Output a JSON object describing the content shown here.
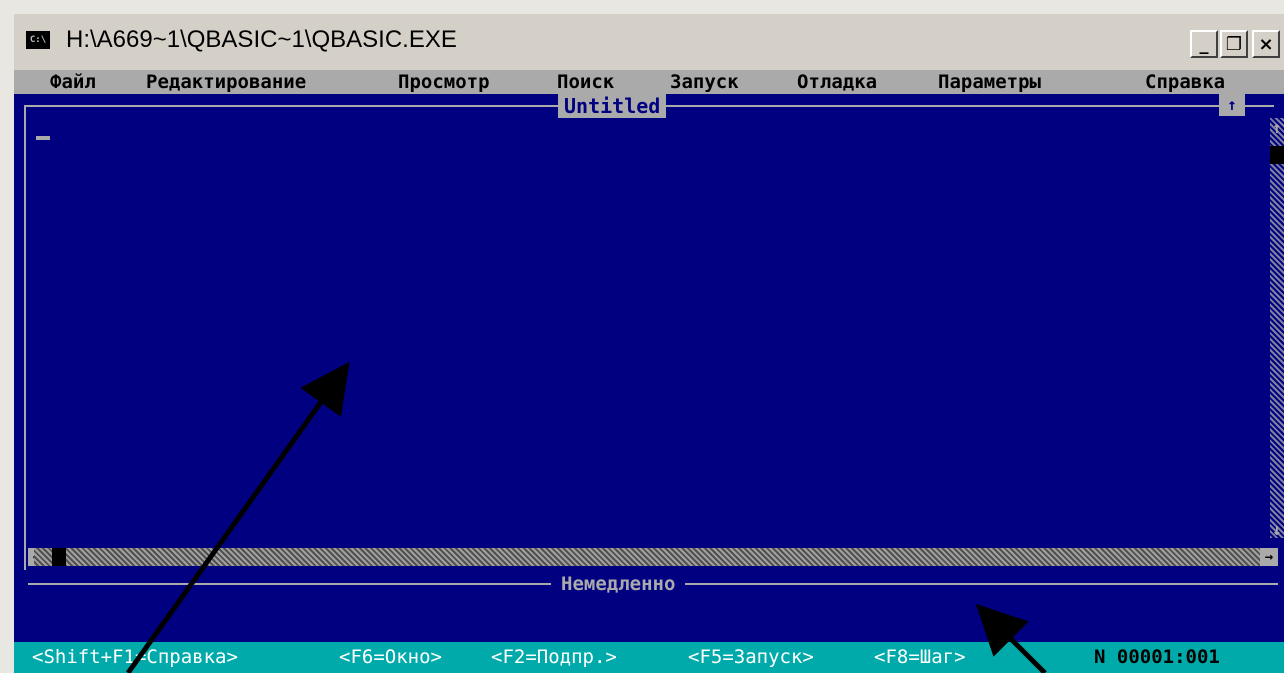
{
  "window": {
    "title": "H:\\A669~1\\QBASIC~1\\QBASIC.EXE",
    "icon_label": "C:\\",
    "minimize_glyph": "_",
    "restore_glyph": "❐",
    "close_glyph": "×"
  },
  "menu": {
    "items": [
      "Файл",
      "Редактирование",
      "Просмотр",
      "Поиск",
      "Запуск",
      "Отладка",
      "Параметры",
      "Справка"
    ]
  },
  "editor": {
    "title": "Untitled",
    "maximize_glyph": "↑"
  },
  "scrollbars": {
    "left_arrow": "←",
    "right_arrow": "→",
    "up_arrow": "↑",
    "down_arrow": "↓"
  },
  "immediate": {
    "title": "Немедленно"
  },
  "statusbar": {
    "items": [
      "<Shift+F1=Справка>",
      "<F6=Окно>",
      "<F2=Подпр.>",
      "<F5=Запуск>",
      "<F8=Шаг>"
    ],
    "position": "N 00001:001"
  },
  "colors": {
    "screen_bg": "#000080",
    "menu_bg": "#aaaaaa",
    "status_bg": "#00aaaa",
    "frame": "#aaaaaa"
  },
  "icons": [
    "console-app-icon",
    "minimize-icon",
    "restore-icon",
    "close-icon",
    "maximize-window-icon",
    "scroll-arrow-icon"
  ]
}
